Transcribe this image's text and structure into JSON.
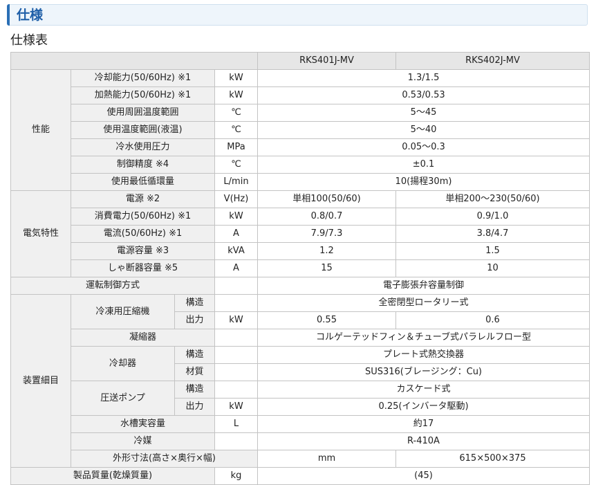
{
  "header": {
    "title": "仕様"
  },
  "subtitle": "仕様表",
  "table": {
    "models": [
      "RKS401J-MV",
      "RKS402J-MV"
    ],
    "groups": {
      "performance": "性能",
      "electrical": "電気特性",
      "equipment": "装置細目"
    },
    "rows": {
      "cooling_capacity": {
        "label": "冷却能力(50/60Hz) ※1",
        "unit": "kW",
        "value": "1.3/1.5"
      },
      "heating_capacity": {
        "label": "加熱能力(50/60Hz) ※1",
        "unit": "kW",
        "value": "0.53/0.53"
      },
      "ambient_temp": {
        "label": "使用周囲温度範囲",
        "unit": "℃",
        "value": "5～45"
      },
      "liquid_temp": {
        "label": "使用温度範囲(液温)",
        "unit": "℃",
        "value": "5～40"
      },
      "water_pressure": {
        "label": "冷水使用圧力",
        "unit": "MPa",
        "value": "0.05～0.3"
      },
      "control_accuracy": {
        "label": "制御精度 ※4",
        "unit": "℃",
        "value": "±0.1"
      },
      "min_circulation": {
        "label": "使用最低循環量",
        "unit": "L/min",
        "value": "10(揚程30m)"
      },
      "power_source": {
        "label": "電源 ※2",
        "unit": "V(Hz)",
        "values": [
          "単相100(50/60)",
          "単相200～230(50/60)"
        ]
      },
      "power_consumption": {
        "label": "消費電力(50/60Hz) ※1",
        "unit": "kW",
        "values": [
          "0.8/0.7",
          "0.9/1.0"
        ]
      },
      "current": {
        "label": "電流(50/60Hz) ※1",
        "unit": "A",
        "values": [
          "7.9/7.3",
          "3.8/4.7"
        ]
      },
      "power_capacity": {
        "label": "電源容量 ※3",
        "unit": "kVA",
        "values": [
          "1.2",
          "1.5"
        ]
      },
      "breaker_capacity": {
        "label": "しゃ断器容量 ※5",
        "unit": "A",
        "values": [
          "15",
          "10"
        ]
      },
      "control_method": {
        "label": "運転制御方式",
        "value": "電子膨張弁容量制御"
      },
      "compressor": {
        "label": "冷凍用圧縮機",
        "structure_label": "構造",
        "structure": "全密閉型ロータリー式",
        "output_label": "出力",
        "output_unit": "kW",
        "outputs": [
          "0.55",
          "0.6"
        ]
      },
      "condenser": {
        "label": "凝縮器",
        "value": "コルゲーテッドフィン＆チューブ式パラレルフロー型"
      },
      "cooler": {
        "label": "冷却器",
        "structure_label": "構造",
        "structure": "プレート式熱交換器",
        "material_label": "材質",
        "material": "SUS316(ブレージング：Cu)"
      },
      "pump": {
        "label": "圧送ポンプ",
        "structure_label": "構造",
        "structure": "カスケード式",
        "output_label": "出力",
        "output_unit": "kW",
        "output": "0.25(インバータ駆動)"
      },
      "tank_volume": {
        "label": "水槽実容量",
        "unit": "L",
        "value": "約17"
      },
      "refrigerant": {
        "label": "冷媒",
        "value": "R-410A"
      },
      "dimensions": {
        "label": "外形寸法(高さ×奥行×幅)",
        "unit": "mm",
        "value": "615×500×375"
      },
      "weight": {
        "label": "製品質量(乾燥質量)",
        "unit": "kg",
        "value": "(45)"
      }
    }
  }
}
